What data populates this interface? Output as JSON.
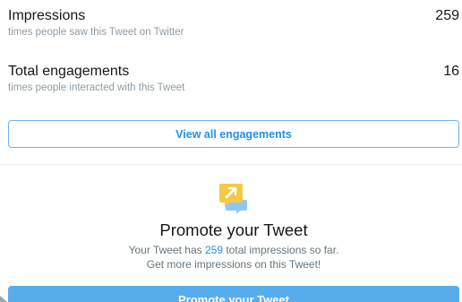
{
  "metrics": [
    {
      "title": "Impressions",
      "value": "259",
      "description": "times people saw this Tweet on Twitter"
    },
    {
      "title": "Total engagements",
      "value": "16",
      "description": "times people interacted with this Tweet"
    }
  ],
  "view_all_button": {
    "label": "View all engagements"
  },
  "promote": {
    "icon": "promote-chat-arrow-icon",
    "title": "Promote your Tweet",
    "line1_prefix": "Your Tweet has ",
    "line1_highlight": "259",
    "line1_suffix": " total impressions so far.",
    "line2": "Get more impressions on this Tweet!",
    "button_label": "Promote your Tweet"
  },
  "colors": {
    "accent": "#2191e6",
    "button_bg": "#57adeb",
    "icon_yellow": "#f6c945",
    "icon_blue": "#8ec8f2"
  }
}
